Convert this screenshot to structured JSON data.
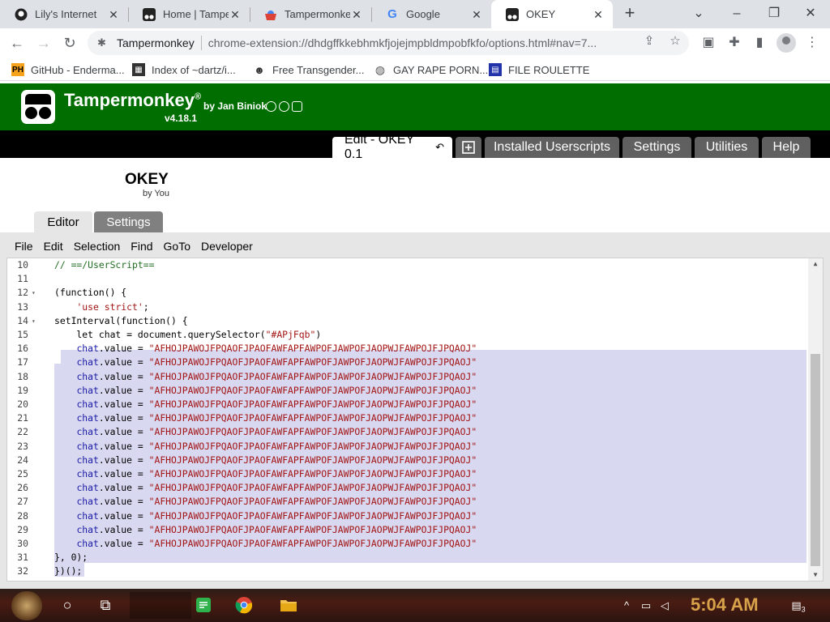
{
  "browser": {
    "tabs": [
      {
        "label": "Lily's Internet",
        "icon": "github-icon"
      },
      {
        "label": "Home | Tamper",
        "icon": "tampermonkey-icon"
      },
      {
        "label": "Tampermonkey",
        "icon": "chrome-webstore-icon"
      },
      {
        "label": "Google",
        "icon": "google-icon"
      },
      {
        "label": "OKEY",
        "icon": "tampermonkey-icon"
      }
    ],
    "active_tab": 4,
    "omnibox_site": "Tampermonkey",
    "omnibox_url": "chrome-extension://dhdgffkkebhmkfjojejmpbldmpobfkfo/options.html#nav=7...",
    "bookmarks": [
      {
        "label": "GitHub - Enderma...",
        "icon": "ph-icon"
      },
      {
        "label": "Index of ~dartz/i...",
        "icon": "folder-icon"
      },
      {
        "label": "Free Transgender...",
        "icon": "site-icon"
      },
      {
        "label": "GAY RAPE PORN...",
        "icon": "globe-icon"
      },
      {
        "label": "FILE ROULETTE",
        "icon": "site-icon"
      }
    ]
  },
  "tampermonkey": {
    "title": "Tampermonkey",
    "registered": "®",
    "author": "by Jan Biniok",
    "version": "v4.18.1",
    "tabs": [
      {
        "label": "Edit - OKEY 0.1"
      },
      {
        "label": "Installed Userscripts"
      },
      {
        "label": "Settings"
      },
      {
        "label": "Utilities"
      },
      {
        "label": "Help"
      }
    ],
    "script": {
      "name": "OKEY",
      "by": "by You"
    },
    "subtabs": [
      {
        "label": "Editor"
      },
      {
        "label": "Settings"
      }
    ],
    "editor_menu": [
      "File",
      "Edit",
      "Selection",
      "Find",
      "GoTo",
      "Developer"
    ]
  },
  "code": {
    "selected_from_line": 17,
    "selected_to_line": 32,
    "lines": [
      {
        "n": "10",
        "fold": false,
        "parts": [
          {
            "c": "cmt",
            "t": "// ==/UserScript=="
          }
        ]
      },
      {
        "n": "11",
        "fold": false,
        "parts": []
      },
      {
        "n": "12",
        "fold": true,
        "parts": [
          {
            "c": "",
            "t": "(function() {"
          }
        ]
      },
      {
        "n": "13",
        "fold": false,
        "parts": [
          {
            "c": "",
            "t": "    "
          },
          {
            "c": "str",
            "t": "'use strict'"
          },
          {
            "c": "",
            "t": ";"
          }
        ]
      },
      {
        "n": "14",
        "fold": true,
        "parts": [
          {
            "c": "",
            "t": "setInterval(function() {"
          }
        ]
      },
      {
        "n": "15",
        "fold": false,
        "parts": [
          {
            "c": "",
            "t": "    let chat = document.querySelector("
          },
          {
            "c": "str",
            "t": "\"#APjFqb\""
          },
          {
            "c": "",
            "t": ")"
          }
        ]
      },
      {
        "n": "16",
        "fold": false,
        "parts": [
          {
            "c": "",
            "t": "    "
          },
          {
            "c": "kw-prop",
            "t": "chat"
          },
          {
            "c": "",
            "t": ".value = "
          },
          {
            "c": "str",
            "t": "\"AFHOJPAWOJFPQAOFJPAOFAWFAPFAWPOFJAWPOFJAOPWJFAWPOJFJPQAOJ\""
          }
        ]
      },
      {
        "n": "17",
        "fold": false,
        "parts": [
          {
            "c": "",
            "t": "    "
          },
          {
            "c": "kw-prop",
            "t": "chat"
          },
          {
            "c": "",
            "t": ".value = "
          },
          {
            "c": "str",
            "t": "\"AFHOJPAWOJFPQAOFJPAOFAWFAPFAWPOFJAWPOFJAOPWJFAWPOJFJPQAOJ\""
          }
        ]
      },
      {
        "n": "18",
        "fold": false,
        "parts": [
          {
            "c": "",
            "t": "    "
          },
          {
            "c": "kw-prop",
            "t": "chat"
          },
          {
            "c": "",
            "t": ".value = "
          },
          {
            "c": "str",
            "t": "\"AFHOJPAWOJFPQAOFJPAOFAWFAPFAWPOFJAWPOFJAOPWJFAWPOJFJPQAOJ\""
          }
        ]
      },
      {
        "n": "19",
        "fold": false,
        "parts": [
          {
            "c": "",
            "t": "    "
          },
          {
            "c": "kw-prop",
            "t": "chat"
          },
          {
            "c": "",
            "t": ".value = "
          },
          {
            "c": "str",
            "t": "\"AFHOJPAWOJFPQAOFJPAOFAWFAPFAWPOFJAWPOFJAOPWJFAWPOJFJPQAOJ\""
          }
        ]
      },
      {
        "n": "20",
        "fold": false,
        "parts": [
          {
            "c": "",
            "t": "    "
          },
          {
            "c": "kw-prop",
            "t": "chat"
          },
          {
            "c": "",
            "t": ".value = "
          },
          {
            "c": "str",
            "t": "\"AFHOJPAWOJFPQAOFJPAOFAWFAPFAWPOFJAWPOFJAOPWJFAWPOJFJPQAOJ\""
          }
        ]
      },
      {
        "n": "21",
        "fold": false,
        "parts": [
          {
            "c": "",
            "t": "    "
          },
          {
            "c": "kw-prop",
            "t": "chat"
          },
          {
            "c": "",
            "t": ".value = "
          },
          {
            "c": "str",
            "t": "\"AFHOJPAWOJFPQAOFJPAOFAWFAPFAWPOFJAWPOFJAOPWJFAWPOJFJPQAOJ\""
          }
        ]
      },
      {
        "n": "22",
        "fold": false,
        "parts": [
          {
            "c": "",
            "t": "    "
          },
          {
            "c": "kw-prop",
            "t": "chat"
          },
          {
            "c": "",
            "t": ".value = "
          },
          {
            "c": "str",
            "t": "\"AFHOJPAWOJFPQAOFJPAOFAWFAPFAWPOFJAWPOFJAOPWJFAWPOJFJPQAOJ\""
          }
        ]
      },
      {
        "n": "23",
        "fold": false,
        "parts": [
          {
            "c": "",
            "t": "    "
          },
          {
            "c": "kw-prop",
            "t": "chat"
          },
          {
            "c": "",
            "t": ".value = "
          },
          {
            "c": "str",
            "t": "\"AFHOJPAWOJFPQAOFJPAOFAWFAPFAWPOFJAWPOFJAOPWJFAWPOJFJPQAOJ\""
          }
        ]
      },
      {
        "n": "24",
        "fold": false,
        "parts": [
          {
            "c": "",
            "t": "    "
          },
          {
            "c": "kw-prop",
            "t": "chat"
          },
          {
            "c": "",
            "t": ".value = "
          },
          {
            "c": "str",
            "t": "\"AFHOJPAWOJFPQAOFJPAOFAWFAPFAWPOFJAWPOFJAOPWJFAWPOJFJPQAOJ\""
          }
        ]
      },
      {
        "n": "25",
        "fold": false,
        "parts": [
          {
            "c": "",
            "t": "    "
          },
          {
            "c": "kw-prop",
            "t": "chat"
          },
          {
            "c": "",
            "t": ".value = "
          },
          {
            "c": "str",
            "t": "\"AFHOJPAWOJFPQAOFJPAOFAWFAPFAWPOFJAWPOFJAOPWJFAWPOJFJPQAOJ\""
          }
        ]
      },
      {
        "n": "26",
        "fold": false,
        "parts": [
          {
            "c": "",
            "t": "    "
          },
          {
            "c": "kw-prop",
            "t": "chat"
          },
          {
            "c": "",
            "t": ".value = "
          },
          {
            "c": "str",
            "t": "\"AFHOJPAWOJFPQAOFJPAOFAWFAPFAWPOFJAWPOFJAOPWJFAWPOJFJPQAOJ\""
          }
        ]
      },
      {
        "n": "27",
        "fold": false,
        "parts": [
          {
            "c": "",
            "t": "    "
          },
          {
            "c": "kw-prop",
            "t": "chat"
          },
          {
            "c": "",
            "t": ".value = "
          },
          {
            "c": "str",
            "t": "\"AFHOJPAWOJFPQAOFJPAOFAWFAPFAWPOFJAWPOFJAOPWJFAWPOJFJPQAOJ\""
          }
        ]
      },
      {
        "n": "28",
        "fold": false,
        "parts": [
          {
            "c": "",
            "t": "    "
          },
          {
            "c": "kw-prop",
            "t": "chat"
          },
          {
            "c": "",
            "t": ".value = "
          },
          {
            "c": "str",
            "t": "\"AFHOJPAWOJFPQAOFJPAOFAWFAPFAWPOFJAWPOFJAOPWJFAWPOJFJPQAOJ\""
          }
        ]
      },
      {
        "n": "29",
        "fold": false,
        "parts": [
          {
            "c": "",
            "t": "    "
          },
          {
            "c": "kw-prop",
            "t": "chat"
          },
          {
            "c": "",
            "t": ".value = "
          },
          {
            "c": "str",
            "t": "\"AFHOJPAWOJFPQAOFJPAOFAWFAPFAWPOFJAWPOFJAOPWJFAWPOJFJPQAOJ\""
          }
        ]
      },
      {
        "n": "30",
        "fold": false,
        "parts": [
          {
            "c": "",
            "t": "    "
          },
          {
            "c": "kw-prop",
            "t": "chat"
          },
          {
            "c": "",
            "t": ".value = "
          },
          {
            "c": "str",
            "t": "\"AFHOJPAWOJFPQAOFJPAOFAWFAPFAWPOFJAWPOFJAOPWJFAWPOJFJPQAOJ\""
          }
        ]
      },
      {
        "n": "31",
        "fold": false,
        "parts": [
          {
            "c": "",
            "t": "}, 0);"
          }
        ]
      },
      {
        "n": "32",
        "fold": false,
        "parts": [
          {
            "c": "",
            "t": "})();"
          }
        ]
      }
    ]
  },
  "taskbar": {
    "clock": "5:04 AM",
    "notifications": "3"
  },
  "colors": {
    "tm_green": "#006e00",
    "selection": "#d8d8f0",
    "string": "#a31515",
    "property": "#1a1aa6",
    "comment": "#236e25"
  }
}
